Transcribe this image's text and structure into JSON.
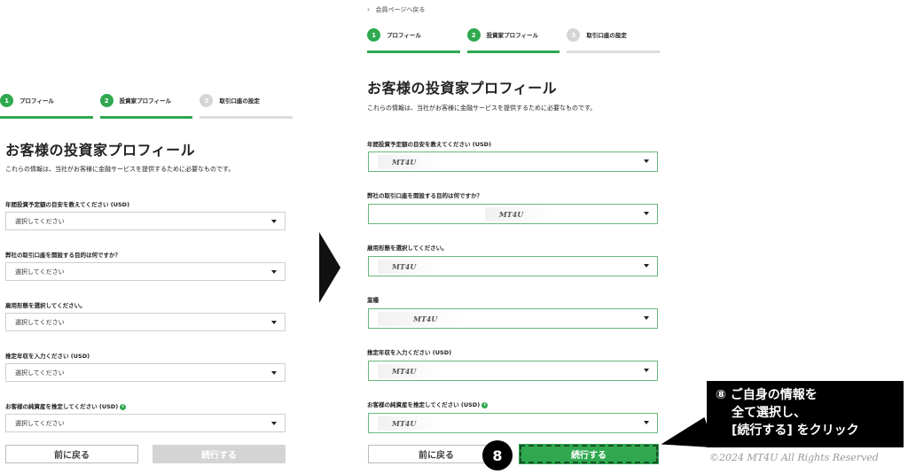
{
  "left": {
    "steps": [
      {
        "num": "1",
        "label": "プロフィール"
      },
      {
        "num": "2",
        "label": "投資家プロフィール"
      },
      {
        "num": "3",
        "label": "取引口座の設定"
      }
    ],
    "title": "お客様の投資家プロフィール",
    "subtitle": "これらの情報は、当社がお客様に金融サービスを提供するために必要なものです。",
    "fields": [
      {
        "label": "年間投資予定額の目安を教えてください (USD)",
        "value": "選択してください"
      },
      {
        "label": "弊社の取引口座を開設する目的は何ですか？",
        "value": "選択してください"
      },
      {
        "label": "雇用形態を選択してください。",
        "value": "選択してください"
      },
      {
        "label": "推定年収を入力ください (USD)",
        "value": "選択してください"
      },
      {
        "label": "お客様の純資産を推定してください (USD)",
        "value": "選択してください"
      }
    ],
    "back_label": "前に戻る",
    "next_label": "続行する"
  },
  "right": {
    "backlink": "会員ページへ戻る",
    "steps": [
      {
        "num": "1",
        "label": "プロフィール"
      },
      {
        "num": "2",
        "label": "投資家プロフィール"
      },
      {
        "num": "3",
        "label": "取引口座の設定"
      }
    ],
    "title": "お客様の投資家プロフィール",
    "subtitle": "これらの情報は、当社がお客様に金融サービスを提供するために必要なものです。",
    "fields": [
      {
        "label": "年間投資予定額の目安を教えてください (USD)",
        "value": "MT4U"
      },
      {
        "label": "弊社の取引口座を開設する目的は何ですか？",
        "value": "MT4U"
      },
      {
        "label": "雇用形態を選択してください。",
        "value": "MT4U"
      },
      {
        "label": "業種",
        "value": "MT4U"
      },
      {
        "label": "推定年収を入力ください (USD)",
        "value": "MT4U"
      },
      {
        "label": "お客様の純資産を推定してください (USD)",
        "value": "MT4U"
      }
    ],
    "back_label": "前に戻る",
    "next_label": "続行する"
  },
  "annotation": {
    "badge": "8",
    "callout_line1": "⑧ ご自身の情報を",
    "callout_line2": "全て選択し、",
    "callout_line3": "[続行する] をクリック",
    "copyright": "©2024 MT4U All Rights Reserved"
  },
  "colors": {
    "accent": "#2fa84f",
    "inactive": "#d5d5d5"
  }
}
